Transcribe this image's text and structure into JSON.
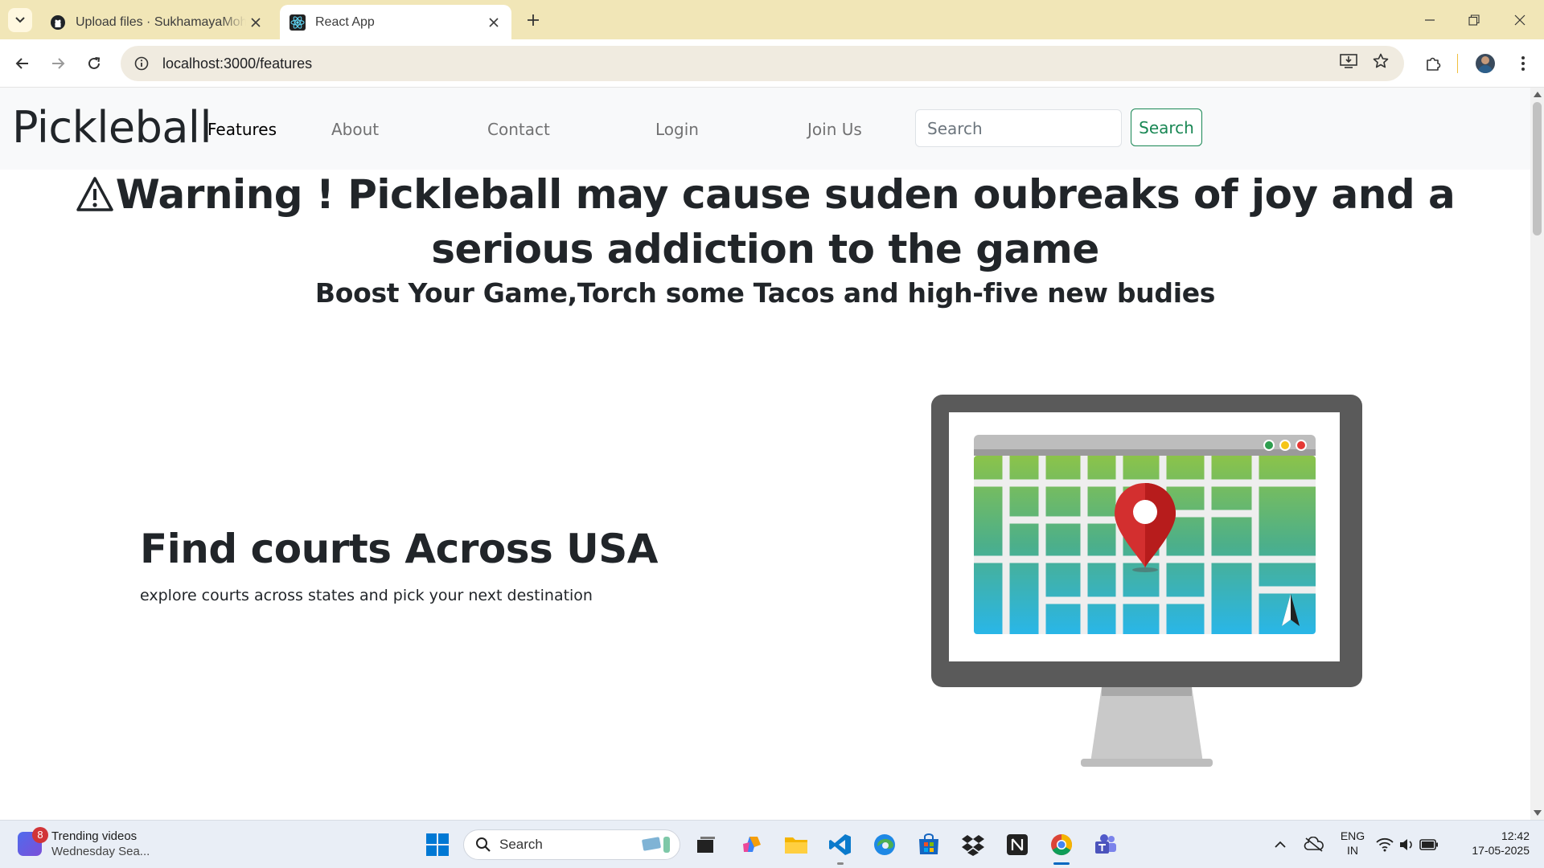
{
  "browser": {
    "tabs": [
      {
        "title": "Upload files · SukhamayaMohap",
        "favicon": "github-icon",
        "active": false
      },
      {
        "title": "React App",
        "favicon": "react-icon",
        "active": true
      }
    ],
    "url": "localhost:3000/features"
  },
  "navbar": {
    "brand": "Pickleball",
    "links": [
      "Features",
      "About",
      "Contact",
      "Login",
      "Join Us"
    ],
    "active_link": "Features",
    "search_placeholder": "Search",
    "search_button": "Search"
  },
  "hero": {
    "warning": "Warning ! Pickleball may cause suden oubreaks of joy and a serious addiction to the game",
    "tagline": "Boost Your Game,Torch some Tacos and high-five new budies"
  },
  "feature": {
    "title": "Find courts Across USA",
    "description": "explore courts across states and pick your next destination",
    "illustration": "monitor-map-pin-illustration"
  },
  "taskbar": {
    "widget_badge": "8",
    "widget_title": "Trending videos",
    "widget_subtitle": "Wednesday Sea...",
    "search_label": "Search",
    "language_line1": "ENG",
    "language_line2": "IN",
    "time": "12:42",
    "date": "17-05-2025"
  },
  "colors": {
    "tabstrip": "#f1e6b7",
    "navbar_bg": "#f8f9fa",
    "search_button": "#198754",
    "map_pin": "#d32f2f"
  }
}
